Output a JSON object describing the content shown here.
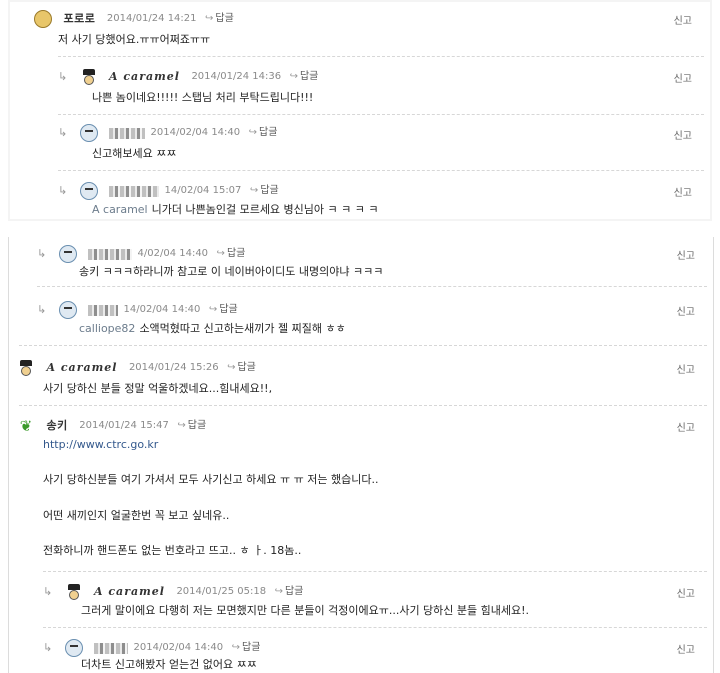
{
  "labels": {
    "reply": "답글",
    "report": "신고",
    "reply_arrow": "↳"
  },
  "icons": {
    "arrow": "reply-arrow-icon",
    "reply": "reply-icon"
  },
  "panel1": [
    {
      "name": "포로로",
      "date": "2014/01/24 14:21",
      "lines": [
        "저 사기 당했어요.ㅠㅠ어쩌죠ㅠㅠ"
      ]
    },
    {
      "name": "A caramel",
      "date": "2014/01/24 14:36",
      "lines": [
        "나쁜 놈이네요!!!!! 스탭님 처리 부탁드립니다!!!"
      ]
    },
    {
      "date": "2014/02/04 14:40",
      "lines": [
        "신고해보세요 ㅉㅉ"
      ]
    },
    {
      "date": "14/02/04 15:07",
      "mention": "A caramel",
      "lines": [
        "니가더 나쁜놈인걸 모르세요 병신님아 ㅋ ㅋ ㅋ ㅋ"
      ]
    }
  ],
  "panel2": [
    {
      "date": "4/02/04 14:40",
      "lines": [
        "송키 ㅋㅋㅋ하라니까 참고로 이 네이버아이디도 내명의야냐 ㅋㅋㅋ"
      ]
    },
    {
      "date": "14/02/04 14:40",
      "mention": "calliope82",
      "lines": [
        "소액먹혔따고 신고하는새끼가 젤 찌질해 ㅎㅎ"
      ]
    },
    {
      "name": "A caramel",
      "date": "2014/01/24 15:26",
      "lines": [
        "사기 당하신 분들 정말 억울하겠네요...힘내세요!!,"
      ]
    },
    {
      "name": "송키",
      "date": "2014/01/24 15:47",
      "link": "http://www.ctrc.go.kr",
      "lines": [
        "사기 당하신분들 여기 가셔서 모두 사기신고 하세요 ㅠ ㅠ 저는 했습니다..",
        "어떤 새끼인지 얼굴한번 꼭 보고 싶네유..",
        "전화하니까 핸드폰도 없는 번호라고 뜨고.. ㅎ ㅏ. 18놈.."
      ]
    },
    {
      "name": "A caramel",
      "date": "2014/01/25 05:18",
      "lines": [
        "그러게 말이에요 다행히 저는 모면했지만 다른 분들이 걱정이에요ㅠ...사기 당하신 분들 힘내세요!."
      ]
    },
    {
      "date": "2014/02/04 14:40",
      "lines": [
        "더차트 신고해봤자 얻는건 없어요 ㅉㅉ"
      ]
    }
  ]
}
